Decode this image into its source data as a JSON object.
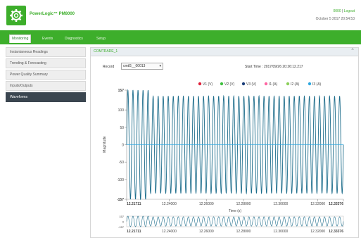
{
  "app": {
    "title": "PowerLogic™ PM8000"
  },
  "header": {
    "user": "0000",
    "logout_label": "Logout",
    "datetime": "October 5 2017 20:54:53"
  },
  "nav": {
    "tabs": [
      {
        "label": "Monitoring"
      },
      {
        "label": "Events"
      },
      {
        "label": "Diagnostics"
      },
      {
        "label": "Setup"
      }
    ]
  },
  "sidebar": {
    "items": [
      {
        "label": "Instantaneous Readings"
      },
      {
        "label": "Trending & Forecasting"
      },
      {
        "label": "Power Quality Summary"
      },
      {
        "label": "Inputs/Outputs"
      },
      {
        "label": "Waveforms"
      }
    ]
  },
  "panel": {
    "title": "COMTRADE_1"
  },
  "record": {
    "label": "Record",
    "value": "cmtG__00013"
  },
  "start_time": "Start Time : 2017/09/26 20:26:12.217",
  "colors": {
    "brand": "#3dae2b",
    "wave": "#1f6e8c",
    "sidebar_active": "#3b4650"
  },
  "icons": {
    "logo": "settings-gear-icon",
    "collapse": "chevron-up-icon",
    "select": "caret-down-icon"
  },
  "chart_data": {
    "type": "line",
    "ylabel": "Magnitude",
    "xlabel": "Time (s)",
    "ylim": [
      -157,
      157
    ],
    "xlim": [
      12.21711,
      12.33376
    ],
    "y_ticks": [
      "157",
      "100",
      "50",
      "0",
      "-50",
      "-100",
      "-157"
    ],
    "x_ticks": [
      "12.21711",
      "12.24000",
      "12.26000",
      "12.28000",
      "12.30000",
      "12.32000",
      "12.33376"
    ],
    "legend": [
      "V1 (V)",
      "V2 (V)",
      "V3 (V)",
      "I1 (A)",
      "I2 (A)",
      "I3 (A)"
    ],
    "legend_colors": [
      "#e0203a",
      "#3fbf3f",
      "#1b3e7a",
      "#ff66a3",
      "#8ccf5a",
      "#2fa8e0"
    ],
    "series": [
      {
        "name": "V3 (V)",
        "peak_before": 157,
        "peak_after": 140,
        "step_time": 12.22915,
        "cycles": 43
      }
    ],
    "overview": {
      "y_ticks": [
        "157",
        "0",
        "-157"
      ],
      "x_ticks": [
        "12.21711",
        "12.24000",
        "12.26000",
        "12.28000",
        "12.30000",
        "12.32000",
        "12.33376"
      ]
    }
  }
}
